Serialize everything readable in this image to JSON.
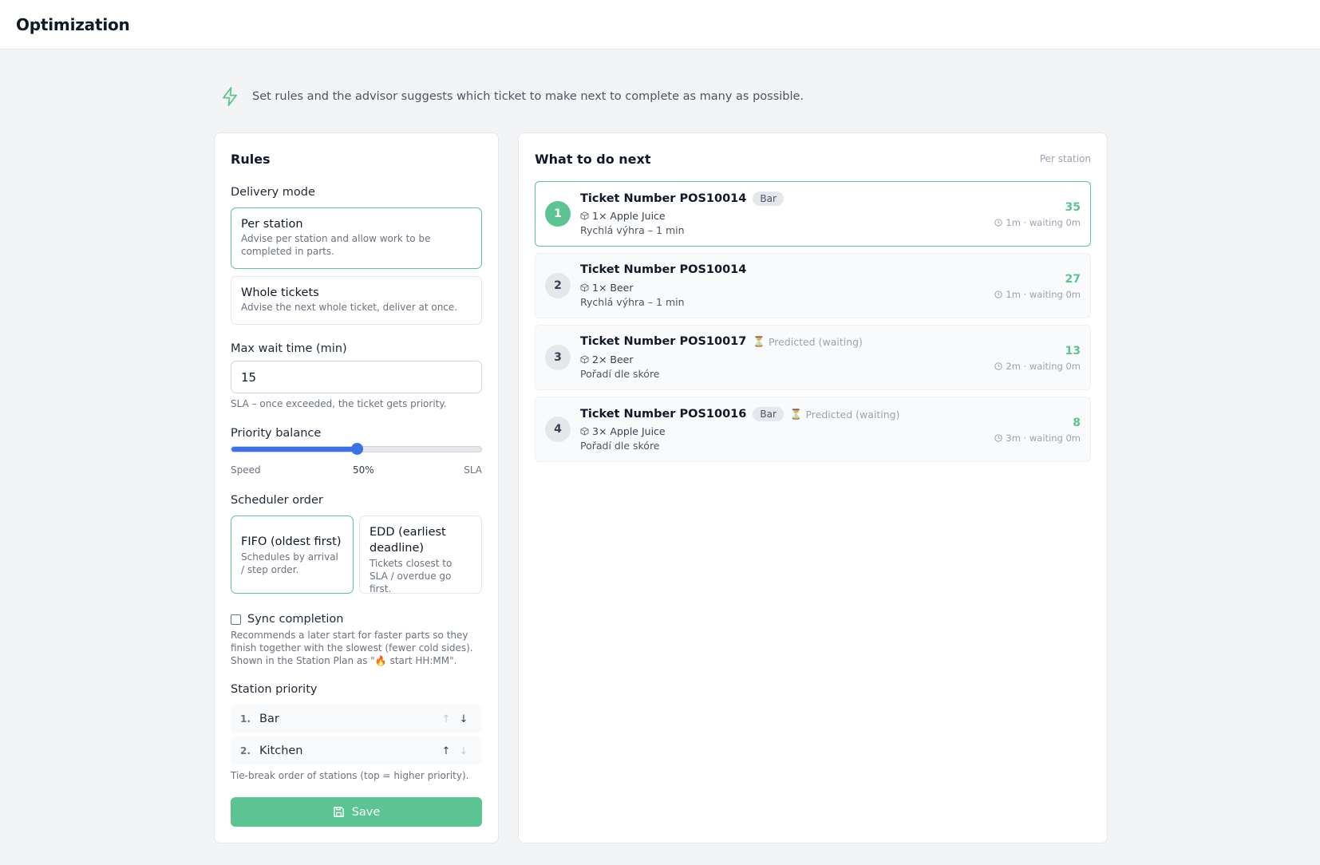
{
  "header": {
    "title": "Optimization"
  },
  "intro": {
    "text": "Set rules and the advisor suggests which ticket to make next to complete as many as possible."
  },
  "rules": {
    "title": "Rules",
    "delivery_mode_label": "Delivery mode",
    "delivery_options": [
      {
        "title": "Per station",
        "desc": "Advise per station and allow work to be completed in parts.",
        "selected": true
      },
      {
        "title": "Whole tickets",
        "desc": "Advise the next whole ticket, deliver at once.",
        "selected": false
      }
    ],
    "max_wait_label": "Max wait time (min)",
    "max_wait_value": "15",
    "max_wait_help": "SLA – once exceeded, the ticket gets priority.",
    "priority_label": "Priority balance",
    "priority_value": 50,
    "priority_value_text": "50%",
    "priority_left": "Speed",
    "priority_right": "SLA",
    "scheduler_label": "Scheduler order",
    "scheduler_options": [
      {
        "title": "FIFO (oldest first)",
        "desc": "Schedules by arrival / step order.",
        "selected": true
      },
      {
        "title": "EDD (earliest deadline)",
        "desc": "Tickets closest to SLA / overdue go first.",
        "selected": false
      }
    ],
    "sync_label": "Sync completion",
    "sync_checked": false,
    "sync_help": "Recommends a later start for faster parts so they finish together with the slowest (fewer cold sides). Shown in the Station Plan as \"🔥 start HH:MM\".",
    "station_priority_label": "Station priority",
    "stations": [
      {
        "index": "1.",
        "name": "Bar"
      },
      {
        "index": "2.",
        "name": "Kitchen"
      }
    ],
    "station_help": "Tie-break order of stations (top = higher priority).",
    "save_label": "Save"
  },
  "next": {
    "title": "What to do next",
    "mode_tag": "Per station",
    "tickets": [
      {
        "rank": "1",
        "title": "Ticket Number POS10014",
        "badge": "Bar",
        "predicted": "",
        "item": "1× Apple Juice",
        "reason": "Rychlá výhra – 1 min",
        "score": "35",
        "meta": "1m · waiting 0m"
      },
      {
        "rank": "2",
        "title": "Ticket Number POS10014",
        "badge": "",
        "predicted": "",
        "item": "1× Beer",
        "reason": "Rychlá výhra – 1 min",
        "score": "27",
        "meta": "1m · waiting 0m"
      },
      {
        "rank": "3",
        "title": "Ticket Number POS10017",
        "badge": "",
        "predicted": "Predicted (waiting)",
        "item": "2× Beer",
        "reason": "Pořadí dle skóre",
        "score": "13",
        "meta": "2m · waiting 0m"
      },
      {
        "rank": "4",
        "title": "Ticket Number POS10016",
        "badge": "Bar",
        "predicted": "Predicted (waiting)",
        "item": "3× Apple Juice",
        "reason": "Pořadí dle skóre",
        "score": "8",
        "meta": "3m · waiting 0m"
      }
    ]
  },
  "colors": {
    "accent": "#5bc492",
    "slider": "#3b73e6"
  },
  "icons": {
    "intro": "lightning-icon",
    "save": "floppy-disk-icon",
    "item": "box-icon",
    "meta": "clock-icon",
    "predicted": "hourglass-icon"
  }
}
